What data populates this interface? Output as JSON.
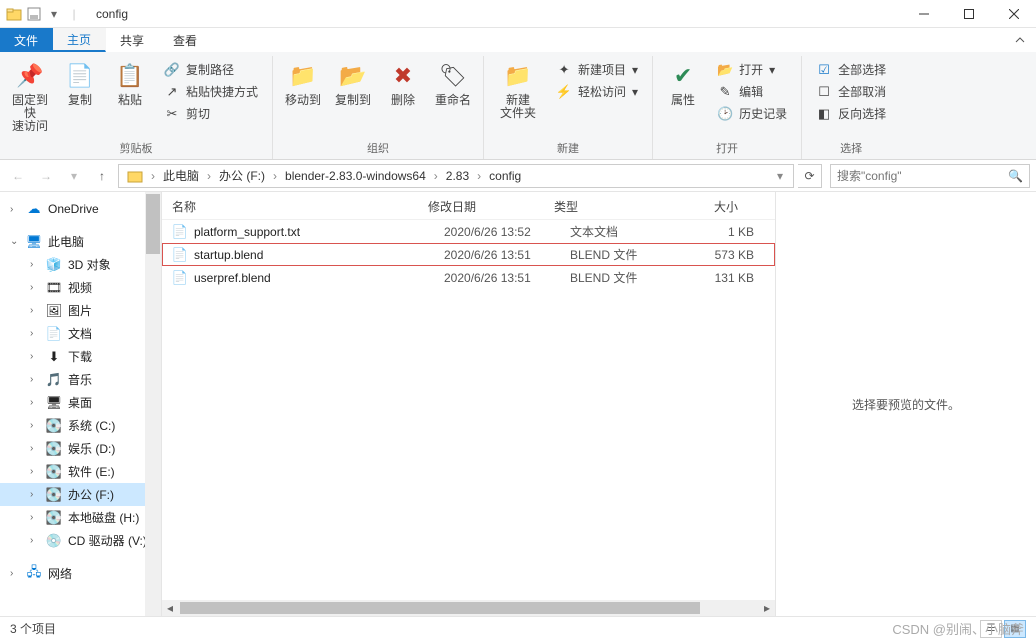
{
  "window": {
    "title": "config"
  },
  "tabs": {
    "file": "文件",
    "home": "主页",
    "share": "共享",
    "view": "查看"
  },
  "ribbon": {
    "pin": "固定到快\n速访问",
    "copy": "复制",
    "paste": "粘贴",
    "copy_path": "复制路径",
    "paste_shortcut": "粘贴快捷方式",
    "cut": "剪切",
    "group_clipboard": "剪贴板",
    "move_to": "移动到",
    "copy_to": "复制到",
    "delete": "删除",
    "rename": "重命名",
    "group_organize": "组织",
    "new_folder": "新建\n文件夹",
    "new_item": "新建项目",
    "easy_access": "轻松访问",
    "group_new": "新建",
    "properties": "属性",
    "open": "打开",
    "edit": "编辑",
    "history": "历史记录",
    "group_open": "打开",
    "select_all": "全部选择",
    "select_none": "全部取消",
    "invert": "反向选择",
    "group_select": "选择"
  },
  "breadcrumb": {
    "items": [
      "此电脑",
      "办公 (F:)",
      "blender-2.83.0-windows64",
      "2.83",
      "config"
    ]
  },
  "search": {
    "placeholder": "搜索\"config\""
  },
  "sidebar": {
    "onedrive": "OneDrive",
    "this_pc": "此电脑",
    "items": [
      {
        "label": "3D 对象",
        "icon": "cube"
      },
      {
        "label": "视频",
        "icon": "video"
      },
      {
        "label": "图片",
        "icon": "image"
      },
      {
        "label": "文档",
        "icon": "doc"
      },
      {
        "label": "下载",
        "icon": "download"
      },
      {
        "label": "音乐",
        "icon": "music"
      },
      {
        "label": "桌面",
        "icon": "desktop"
      },
      {
        "label": "系统 (C:)",
        "icon": "drive"
      },
      {
        "label": "娱乐 (D:)",
        "icon": "drive"
      },
      {
        "label": "软件 (E:)",
        "icon": "drive"
      },
      {
        "label": "办公 (F:)",
        "icon": "drive",
        "selected": true
      },
      {
        "label": "本地磁盘 (H:)",
        "icon": "drive"
      },
      {
        "label": "CD 驱动器 (V:)",
        "icon": "cd"
      }
    ],
    "network": "网络"
  },
  "columns": {
    "name": "名称",
    "date": "修改日期",
    "type": "类型",
    "size": "大小"
  },
  "files": [
    {
      "name": "platform_support.txt",
      "date": "2020/6/26 13:52",
      "type": "文本文档",
      "size": "1 KB",
      "highlight": false
    },
    {
      "name": "startup.blend",
      "date": "2020/6/26 13:51",
      "type": "BLEND 文件",
      "size": "573 KB",
      "highlight": true
    },
    {
      "name": "userpref.blend",
      "date": "2020/6/26 13:51",
      "type": "BLEND 文件",
      "size": "131 KB",
      "highlight": false
    }
  ],
  "preview": {
    "empty": "选择要预览的文件。"
  },
  "status": {
    "count": "3 个项目"
  },
  "watermark": "CSDN @别闹、小脑斧"
}
